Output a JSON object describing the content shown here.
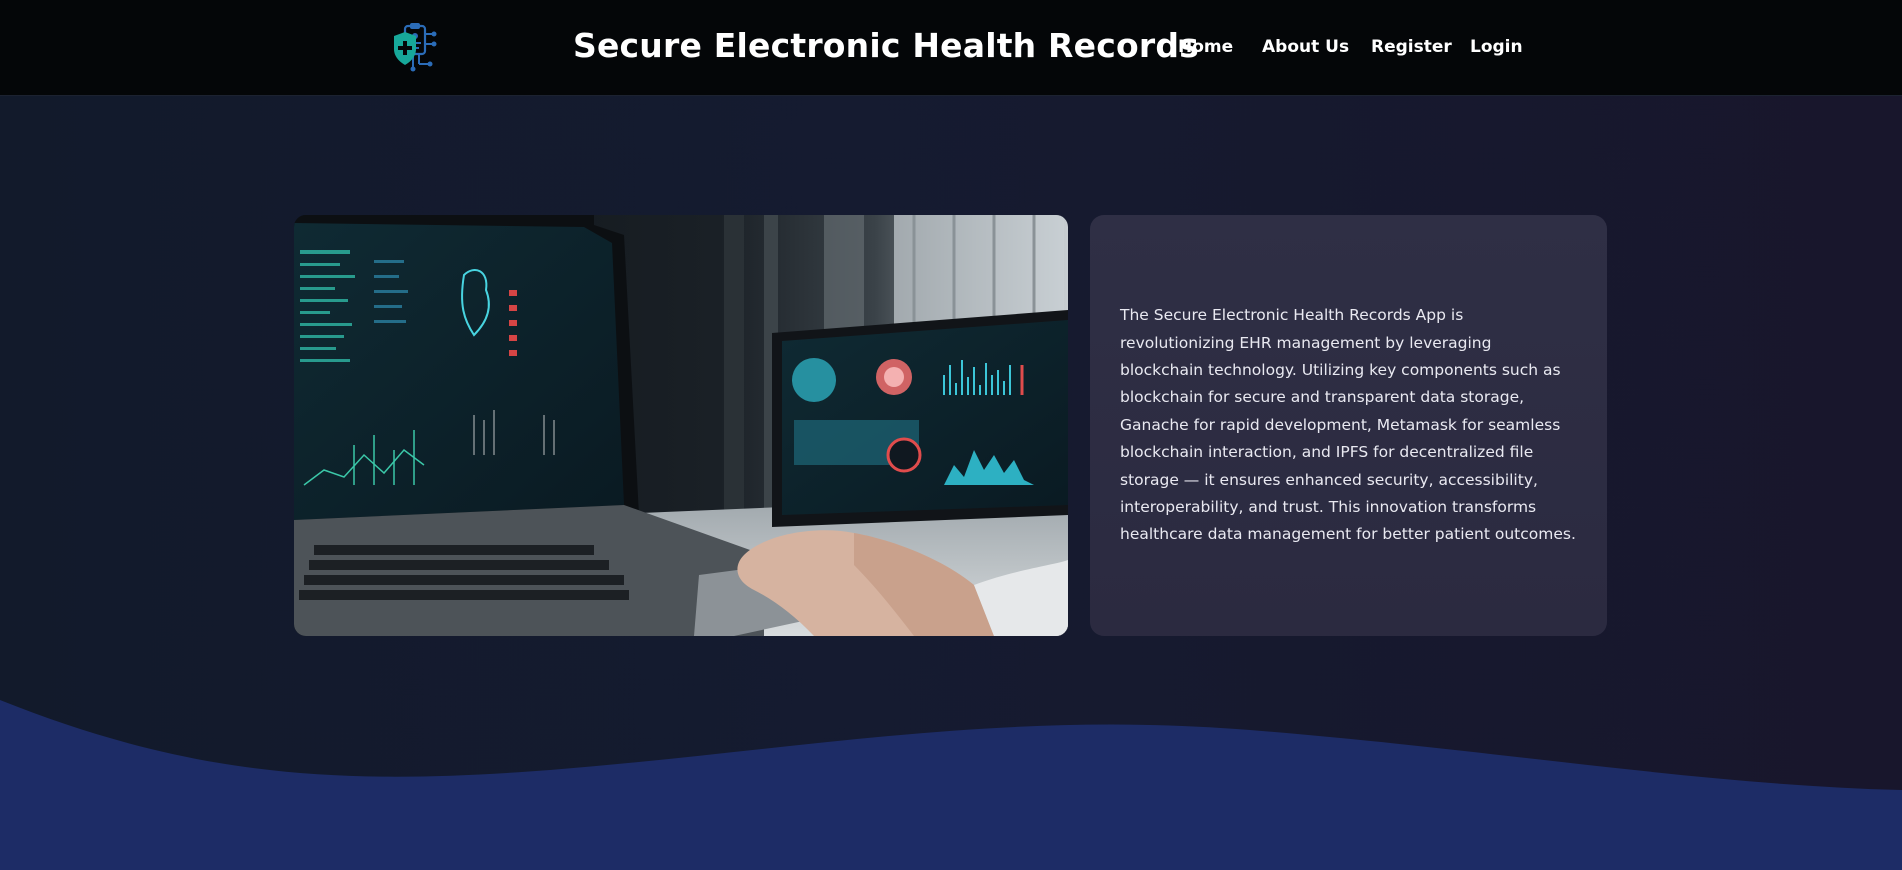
{
  "header": {
    "title": "Secure Electronic Health Records",
    "logo_icon": "shield-medical-network-icon",
    "nav": [
      {
        "label": "Home"
      },
      {
        "label": "About Us"
      },
      {
        "label": "Register"
      },
      {
        "label": "Login"
      }
    ]
  },
  "main": {
    "hero_image_icon": "laptop-health-dashboard-photo",
    "description": "The Secure Electronic Health Records App is revolutionizing EHR management by leveraging blockchain technology. Utilizing key components such as blockchain for secure and transparent data storage, Ganache for rapid development, Metamask for seamless blockchain interaction, and IPFS for decentralized file storage — it ensures enhanced security, accessibility, interoperability, and trust. This innovation transforms healthcare data management for better patient outcomes."
  },
  "colors": {
    "header_bg": "#040608",
    "page_bg": "#131a2c",
    "card_bg": "#2e2e44",
    "wave": "#1d2c66",
    "logo_teal": "#17a89a",
    "logo_blue": "#2b6cb8"
  }
}
